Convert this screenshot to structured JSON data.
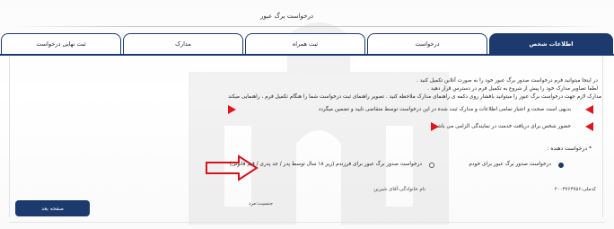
{
  "page": {
    "title": "درخواست برگ عبور"
  },
  "tabs": [
    {
      "label": "اطلاعات شخص",
      "active": true
    },
    {
      "label": "درخواست",
      "active": false
    },
    {
      "label": "ثبت همراه",
      "active": false
    },
    {
      "label": "مدارک",
      "active": false
    },
    {
      "label": "ثبت نهایی درخواست",
      "active": false
    }
  ],
  "instructions": [
    "در اینجا میتوانید فرم درخواست صدور برگ عبور خود را به صورت آنلاین تکمیل کنید .",
    "لطفا تصاویر مدارک خود را پیش از شروع به تکمیل فرم در دسترس قرار دهید .",
    "مدارک لازم جهت درخواست برگ عبور را میتوانید بافشار روی دکمه ی راهنمای مدارک ملاحظه کنید . تصویر راهنمای ثبت درخواست شما را هنگام تکمیل فرم ، راهنمایی میکند"
  ],
  "notices": [
    "بدیهی است صحت و اعتبار تمامی اطلاعات و مدارک ثبت شده در این درخواست توسط متقاضی تایید و تضمین میگردد",
    "حضور شخص برای دریافت خدمت در نمایندگی الزامی می باشد ."
  ],
  "applicant": {
    "label": "* درخواست دهنده :",
    "options": [
      {
        "label": "درخواست صدور برگ عبور برای خودم",
        "checked": true
      },
      {
        "label": "درخواست صدور برگ عبور برای فرزندم (زیر ۱۸ سال توسط پدر / جد پدری / قیم قانونی)",
        "checked": false
      }
    ]
  },
  "person_info": {
    "national_code": "کدملی:۲۰۰۳۷۶۳۷۵۶",
    "name": "نام خانوادگی:آقای شیرین",
    "gender": "جنسیت:مرد"
  },
  "buttons": {
    "next_label": "صفحه بعد"
  },
  "colors": {
    "primary": "#1c3a6e",
    "alert": "#e1141c"
  }
}
